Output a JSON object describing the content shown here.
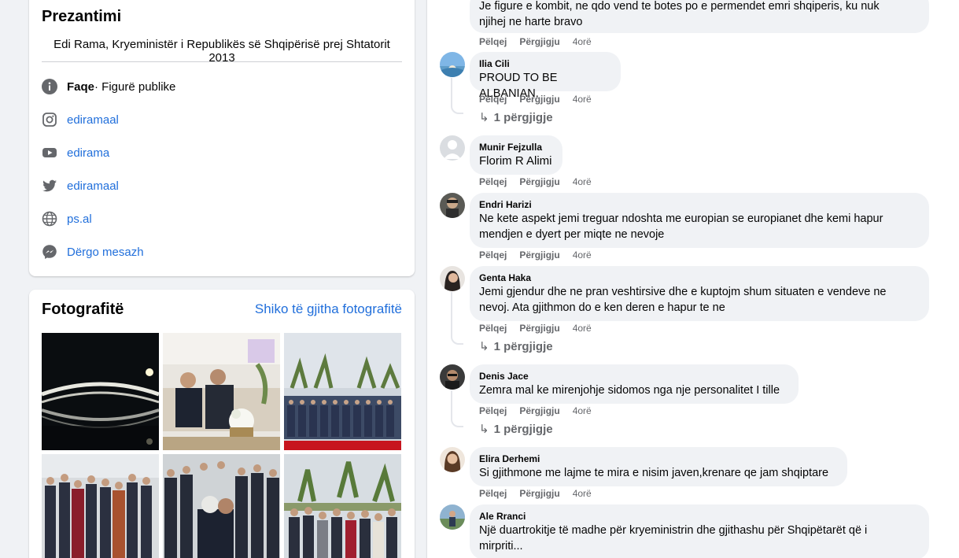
{
  "intro": {
    "title": "Prezantimi",
    "bio": "Edi Rama, Kryeministër i Republikës së Shqipërisë prej Shtatorit 2013",
    "rows": [
      {
        "icon": "info-icon",
        "bold": "Faqe",
        "text": " · Figurë publike"
      },
      {
        "icon": "instagram-icon",
        "text": "ediramaal"
      },
      {
        "icon": "youtube-icon",
        "text": "edirama"
      },
      {
        "icon": "twitter-icon",
        "text": "ediramaal"
      },
      {
        "icon": "globe-icon",
        "text": "ps.al"
      },
      {
        "icon": "messenger-icon",
        "text": "Dërgo mesazh"
      }
    ]
  },
  "photos": {
    "title": "Fotografitë",
    "see_all": "Shiko të gjitha fotografitë"
  },
  "comment_actions": {
    "like": "Pëlqej",
    "reply": "Përgjigju"
  },
  "comments": [
    {
      "author": "",
      "text_lines": [
        "Je figure e kombit, ne qdo vend te botes po e permendet emri shqiperis, ku nuk",
        "njihej ne harte bravo"
      ],
      "time": "4orë"
    },
    {
      "author": "Ilia Cili",
      "text_lines": [
        "PROUD TO BE ALBANIAN."
      ],
      "time": "4orë",
      "replies": "1 përgjigje"
    },
    {
      "author": "Munir Fejzulla",
      "text_lines": [
        "Florim R Alimi"
      ],
      "time": "4orë"
    },
    {
      "author": "Endri Harizi",
      "text_lines": [
        "Ne kete aspekt jemi treguar ndoshta me europian se europianet dhe kemi hapur",
        "mendjen e dyert per miqte ne nevoje"
      ],
      "time": "4orë"
    },
    {
      "author": "Genta Haka",
      "text_lines": [
        "Jemi gjendur dhe ne pran veshtirsive dhe e kuptojm shum situaten e vendeve ne",
        "nevoj. Ata gjithmon do e ken deren e hapur te ne"
      ],
      "time": "4orë",
      "replies": "1 përgjigje"
    },
    {
      "author": "Denis Jace",
      "text_lines": [
        "Zemra mal ke mirenjohje sidomos nga nje personalitet I tille"
      ],
      "time": "4orë",
      "replies": "1 përgjigje"
    },
    {
      "author": "Elira Derhemi",
      "text_lines": [
        "Si gjithmone me lajme te mira e nisim javen,krenare qe jam shqiptare"
      ],
      "time": "4orë"
    },
    {
      "author": "Ale Rranci",
      "text_lines": [
        "Një duartrokitje të madhe për kryeministrin dhe gjithashu për Shqipëtarët që i",
        "mirpriti..."
      ],
      "time": ""
    }
  ],
  "colors": {
    "link": "#216fdb",
    "bubble": "#f0f2f5",
    "muted": "#65676b"
  }
}
